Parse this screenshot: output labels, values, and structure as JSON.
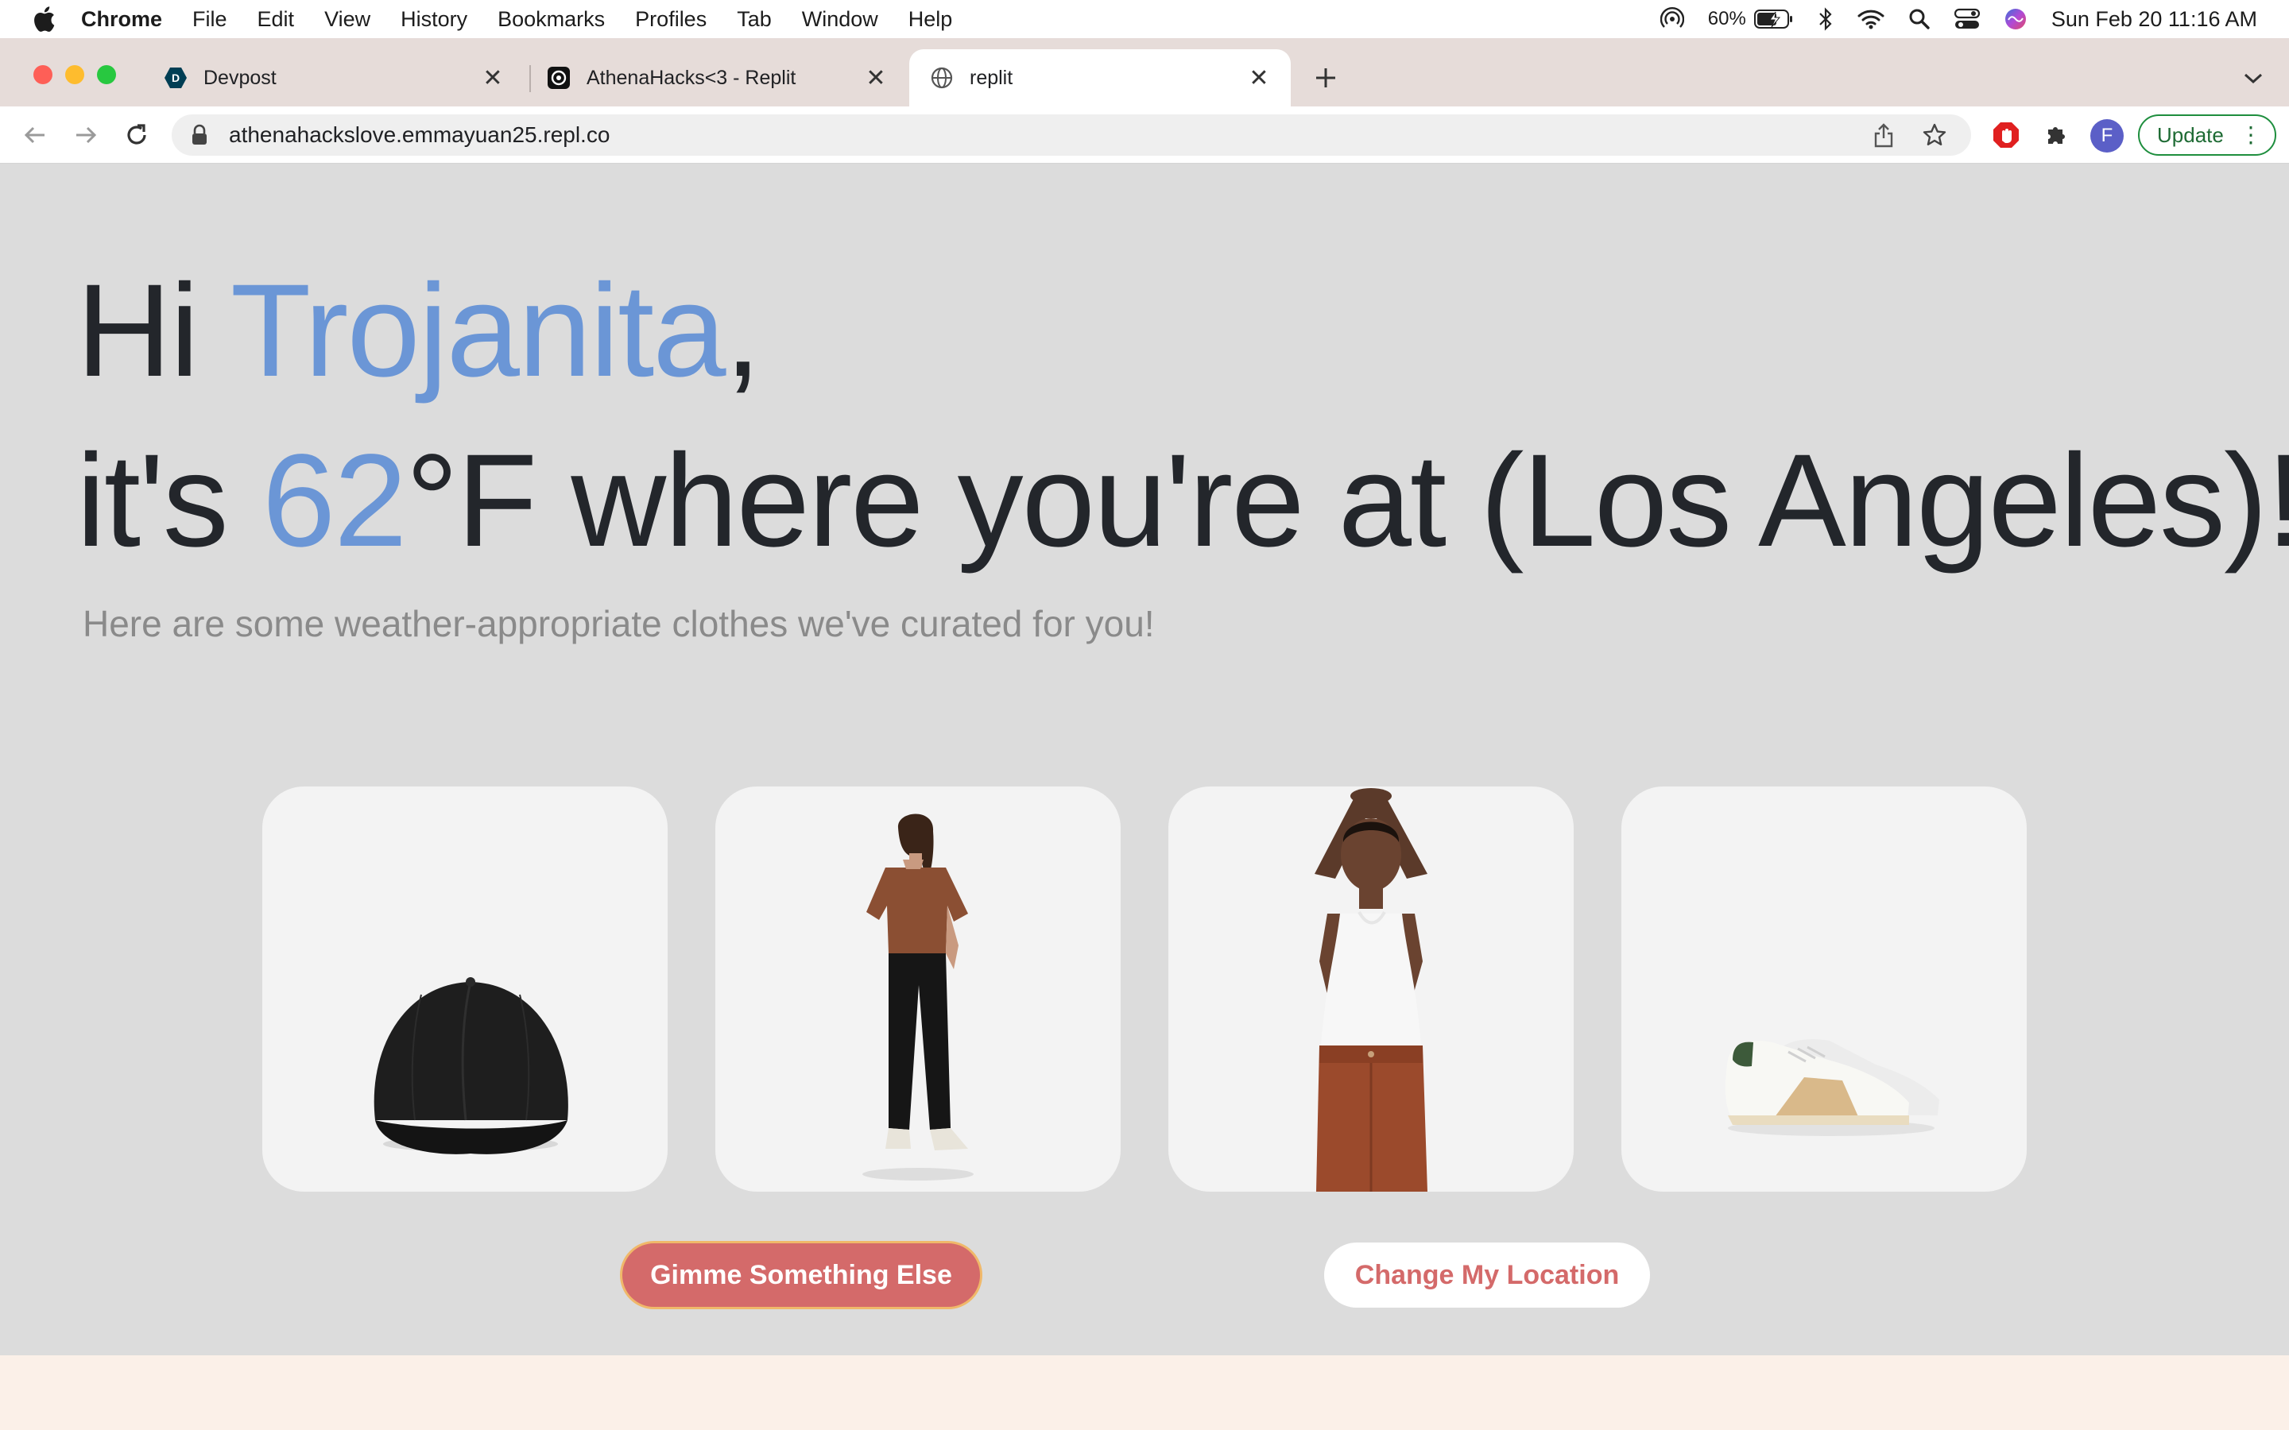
{
  "menubar": {
    "app_name": "Chrome",
    "items": [
      "File",
      "Edit",
      "View",
      "History",
      "Bookmarks",
      "Profiles",
      "Tab",
      "Window",
      "Help"
    ],
    "battery_percent": "60%",
    "clock": "Sun Feb 20  11:16 AM"
  },
  "tabs": [
    {
      "title": "Devpost",
      "icon": "devpost-icon"
    },
    {
      "title": "AthenaHacks<3 - Replit",
      "icon": "replit-icon"
    },
    {
      "title": "replit",
      "icon": "globe-icon"
    }
  ],
  "toolbar": {
    "url": "athenahackslove.emmayuan25.repl.co",
    "profile_initial": "F",
    "update_label": "Update"
  },
  "hero": {
    "greeting_prefix": "Hi ",
    "name": "Trojanita",
    "greeting_suffix": ",",
    "temp_prefix": "it's ",
    "temperature": "62",
    "temp_suffix": "°F where you're at (Los Angeles)!",
    "subtitle": "Here are some weather-appropriate clothes we've curated for you!"
  },
  "products": [
    {
      "item": "black baseball cap"
    },
    {
      "item": "brown t-shirt with black trousers"
    },
    {
      "item": "white tank top with rust pants"
    },
    {
      "item": "white sneakers"
    }
  ],
  "actions": {
    "primary_label": "Gimme Something Else",
    "secondary_label": "Change My Location"
  },
  "colors": {
    "accent": "#6b96d6",
    "button": "#d46a6a"
  }
}
